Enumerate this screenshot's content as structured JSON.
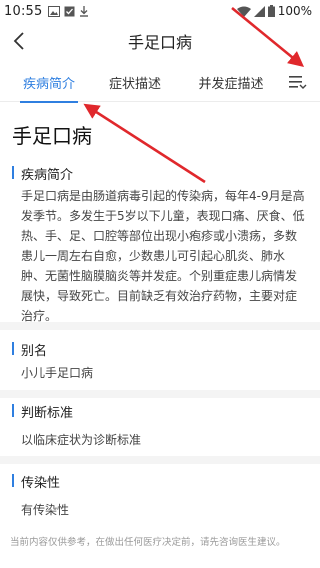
{
  "status_bar": {
    "time": "10:55",
    "battery": "100%"
  },
  "header": {
    "title": "手足口病",
    "back_icon": "chevron-left-icon"
  },
  "tabs": [
    {
      "label": "疾病简介",
      "active": true
    },
    {
      "label": "症状描述",
      "active": false
    },
    {
      "label": "并发症描述",
      "active": false
    }
  ],
  "tab_menu_icon": "list-menu-icon",
  "disease_name": "手足口病",
  "sections": [
    {
      "heading": "疾病简介",
      "body": "手足口病是由肠道病毒引起的传染病，每年4-9月是高发季节。多发生于5岁以下儿童，表现口痛、厌食、低热、手、足、口腔等部位出现小疱疹或小溃疡，多数患儿一周左右自愈，少数患儿可引起心肌炎、肺水肿、无菌性脑膜脑炎等并发症。个别重症患儿病情发展快，导致死亡。目前缺乏有效治疗药物，主要对症治疗。"
    },
    {
      "heading": "别名",
      "body": "小儿手足口病"
    },
    {
      "heading": "判断标准",
      "body": "以临床症状为诊断标准"
    },
    {
      "heading": "传染性",
      "body": "有传染性"
    }
  ],
  "disclaimer": "当前内容仅供参考，在做出任何医疗决定前，请先咨询医生建议。",
  "colors": {
    "accent": "#2f7fe0",
    "annotation": "#e0282c"
  }
}
